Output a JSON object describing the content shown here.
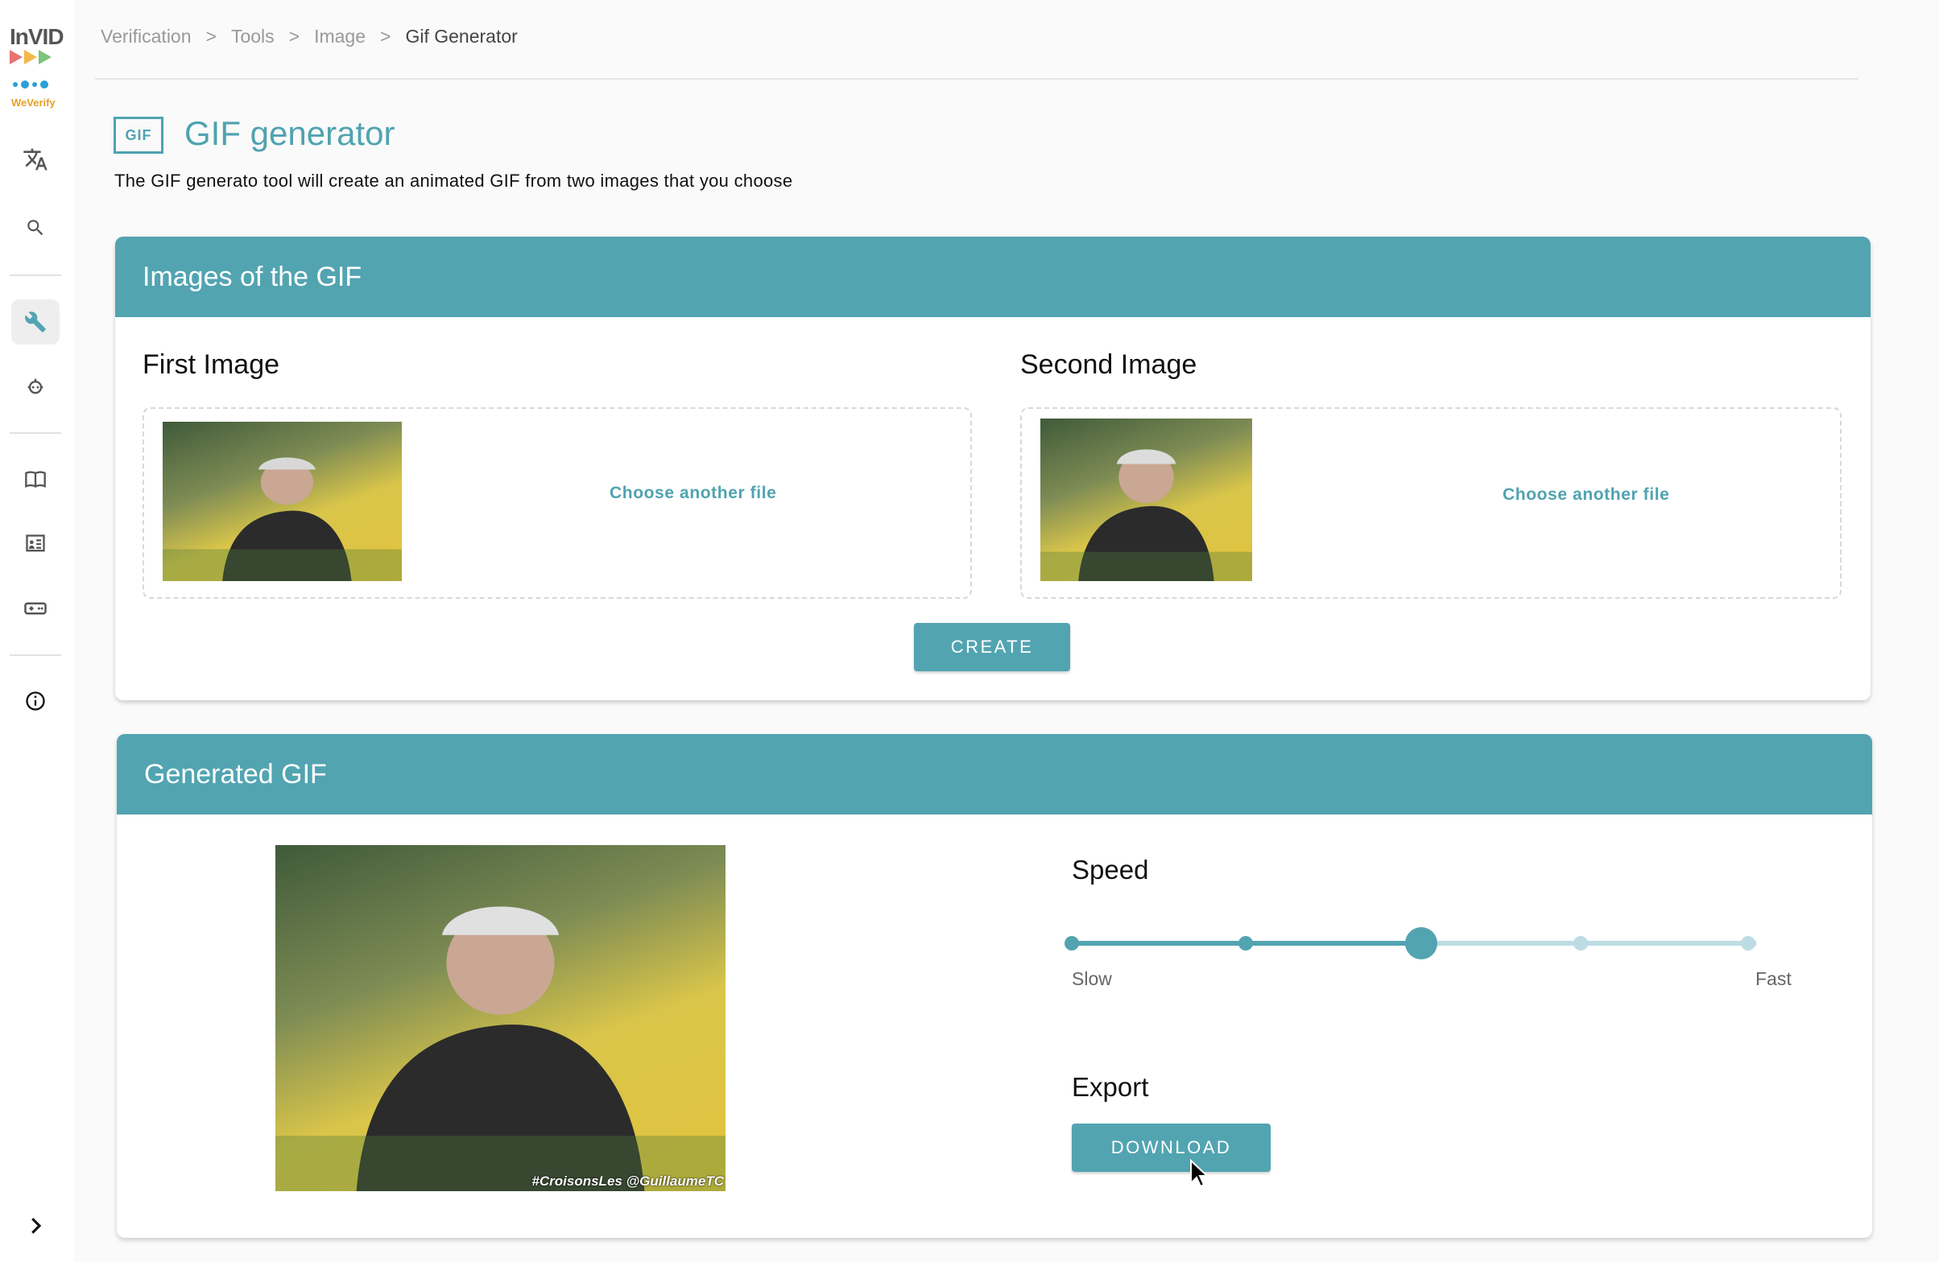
{
  "sidebar": {
    "logo_text": "InVID",
    "logo_sub": "WeVerify",
    "items": [
      {
        "icon": "translate-icon"
      },
      {
        "icon": "search-icon"
      },
      {
        "icon": "wrench-icon"
      },
      {
        "icon": "robot-icon"
      },
      {
        "icon": "book-icon"
      },
      {
        "icon": "classroom-icon"
      },
      {
        "icon": "gamepad-icon"
      },
      {
        "icon": "info-icon"
      },
      {
        "icon": "chevron-right-icon"
      }
    ]
  },
  "breadcrumb": {
    "items": [
      "Verification",
      "Tools",
      "Image",
      "Gif Generator"
    ],
    "separator": ">"
  },
  "header": {
    "badge": "GIF",
    "title": "GIF generator",
    "description": "The GIF generato tool will create an animated GIF from two images that you choose"
  },
  "images_card": {
    "title": "Images of the GIF",
    "first": {
      "label": "First Image",
      "action": "Choose another file"
    },
    "second": {
      "label": "Second Image",
      "action": "Choose another file"
    },
    "create_label": "CREATE"
  },
  "generated_card": {
    "title": "Generated GIF",
    "watermark": "#CroisonsLes @GuillaumeTC",
    "speed": {
      "label": "Speed",
      "min_label": "Slow",
      "max_label": "Fast",
      "steps": 5,
      "selected_step": 3
    },
    "export": {
      "label": "Export",
      "download_label": "DOWNLOAD"
    }
  },
  "colors": {
    "accent": "#52a4b1",
    "accent_light": "#bcdde3"
  }
}
